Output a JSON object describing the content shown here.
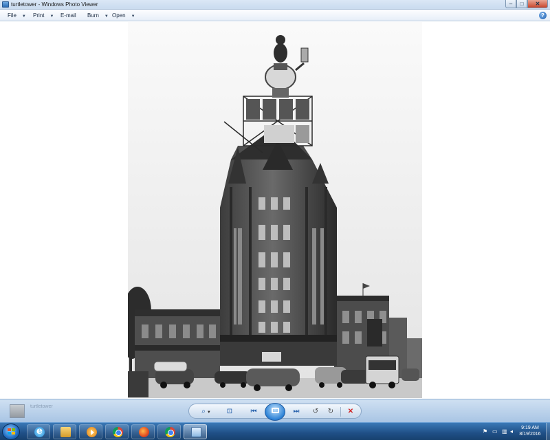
{
  "window": {
    "title": "turtletower - Windows Photo Viewer",
    "min_label": "–",
    "max_label": "□",
    "close_label": "✕"
  },
  "menu": {
    "file": "File",
    "print": "Print",
    "email": "E-mail",
    "burn": "Burn",
    "open": "Open",
    "help": "?"
  },
  "controls": {
    "zoom": "⌕",
    "fit": "⊡",
    "prev": "⏮",
    "next": "⏭",
    "rotate_left": "↺",
    "rotate_right": "↻",
    "delete": "✕"
  },
  "fileinfo": {
    "name": "turtletower"
  },
  "clock": {
    "time": "9:19 AM",
    "date": "8/19/2016"
  },
  "colors": {
    "titlebar": "#c9dbef",
    "controlbar": "#a9c5e4",
    "taskbar": "#1f4f86",
    "accent": "#2c82d6",
    "delete": "#d02323"
  },
  "icons": {
    "app": "photo-viewer-icon",
    "help": "help-icon",
    "start": "windows-start-icon",
    "taskbar": [
      "internet-explorer-icon",
      "file-explorer-icon",
      "media-player-icon",
      "chrome-icon",
      "firefox-icon",
      "chrome-icon",
      "photo-viewer-icon"
    ]
  }
}
